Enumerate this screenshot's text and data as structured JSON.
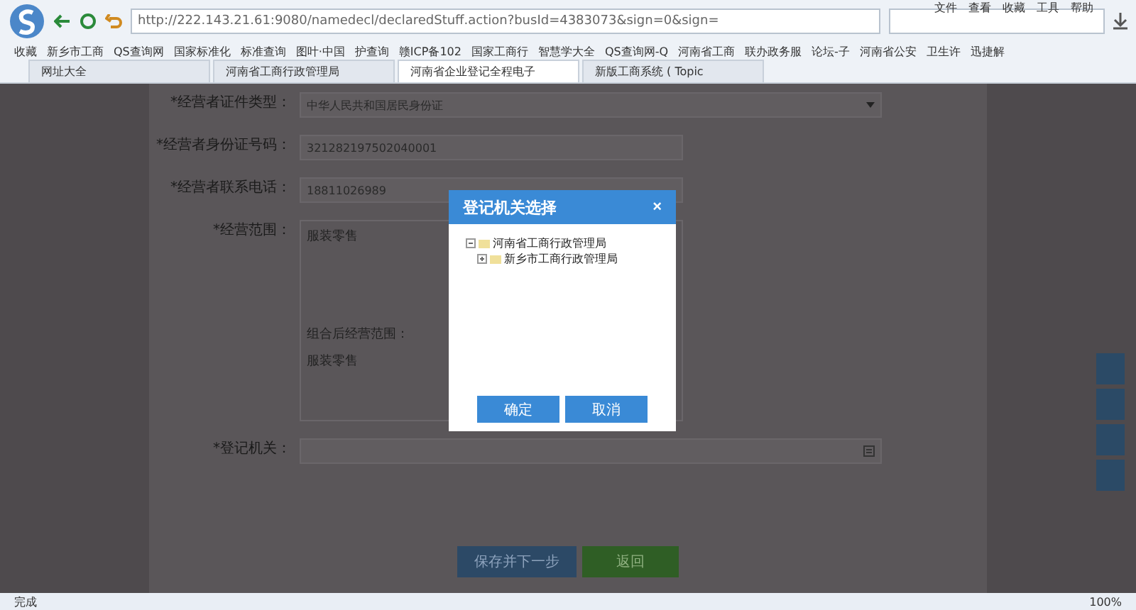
{
  "menu": [
    "文件",
    "查看",
    "收藏",
    "工具",
    "帮助"
  ],
  "address": {
    "url": "http://222.143.21.61:9080/namedecl/declaredStuff.action?busId=4383073&sign=0&sign="
  },
  "bookmarks": [
    "收藏",
    "新乡市工商",
    "QS查询网",
    "国家标准化",
    "标准查询",
    "图叶·中国",
    "护查询",
    "赣ICP备102",
    "国家工商行",
    "智慧学大全",
    "QS查询网-Q",
    "河南省工商",
    "联办政务服",
    "论坛-子",
    "河南省公安",
    "卫生许",
    "迅捷解"
  ],
  "tabs": [
    {
      "label": "网址大全",
      "selected": false
    },
    {
      "label": "河南省工商行政管理局",
      "selected": false
    },
    {
      "label": "河南省企业登记全程电子",
      "selected": true
    },
    {
      "label": "新版工商系统 ( Topic",
      "selected": false
    }
  ],
  "form": {
    "fields": [
      {
        "kind": "select",
        "label": "*经营者证件类型：",
        "value": "中华人民共和国居民身份证"
      },
      {
        "kind": "input",
        "label": "*经营者身份证号码：",
        "value": "321282197502040001"
      },
      {
        "kind": "input",
        "label": "*经营者联系电话：",
        "value": "18811026989"
      },
      {
        "kind": "scope",
        "label": "*经营范围：",
        "value": "服装零售",
        "combined_label": "组合后经营范围：",
        "combined_value": "服装零售"
      },
      {
        "kind": "picker",
        "label": "*登记机关："
      }
    ],
    "buttons": [
      {
        "label": "保存并下一步",
        "kind": "primary"
      },
      {
        "label": "返回",
        "kind": "secondary"
      }
    ]
  },
  "dialog": {
    "title": "登记机关选择",
    "close": "×",
    "tree": [
      {
        "label": "河南省工商行政管理局",
        "expanded": true,
        "children": [
          {
            "label": "新乡市工商行政管理局",
            "expanded": false
          }
        ]
      }
    ],
    "buttons": [
      "确定",
      "取消"
    ]
  },
  "status_bar": {
    "text": "完成",
    "zoom": "100%"
  }
}
